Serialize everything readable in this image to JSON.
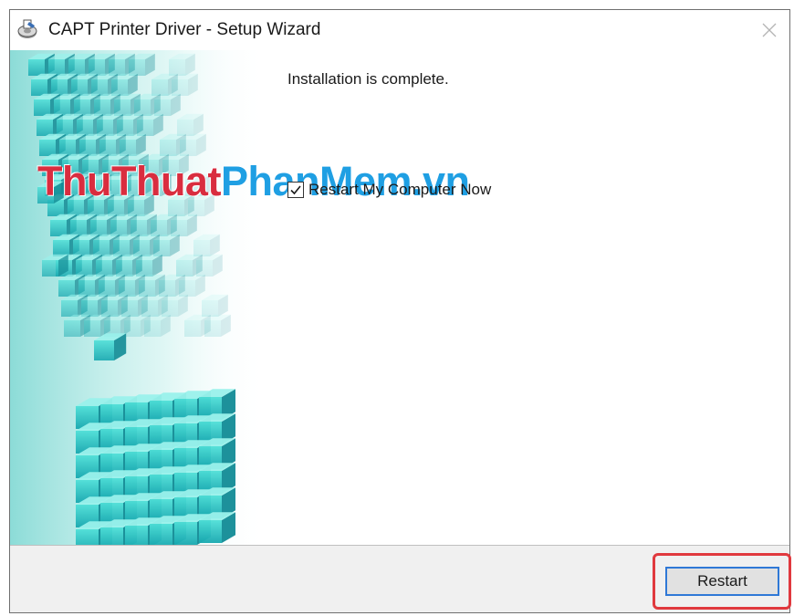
{
  "window": {
    "title": "CAPT Printer Driver - Setup Wizard",
    "icon": "printer-setup-icon"
  },
  "watermark": {
    "part1": "ThuThuat",
    "part2": "PhanMem.vn"
  },
  "main": {
    "message": "Installation is complete.",
    "restart_checkbox": {
      "label": "Restart My Computer Now",
      "checked": true
    }
  },
  "footer": {
    "restart_button_label": "Restart"
  },
  "colors": {
    "watermark_red": "#d92d3f",
    "watermark_blue": "#1f9fe3",
    "highlight_red": "#e0393e",
    "focus_blue": "#2f78d6",
    "cube_teal": "#2ec9c4"
  }
}
